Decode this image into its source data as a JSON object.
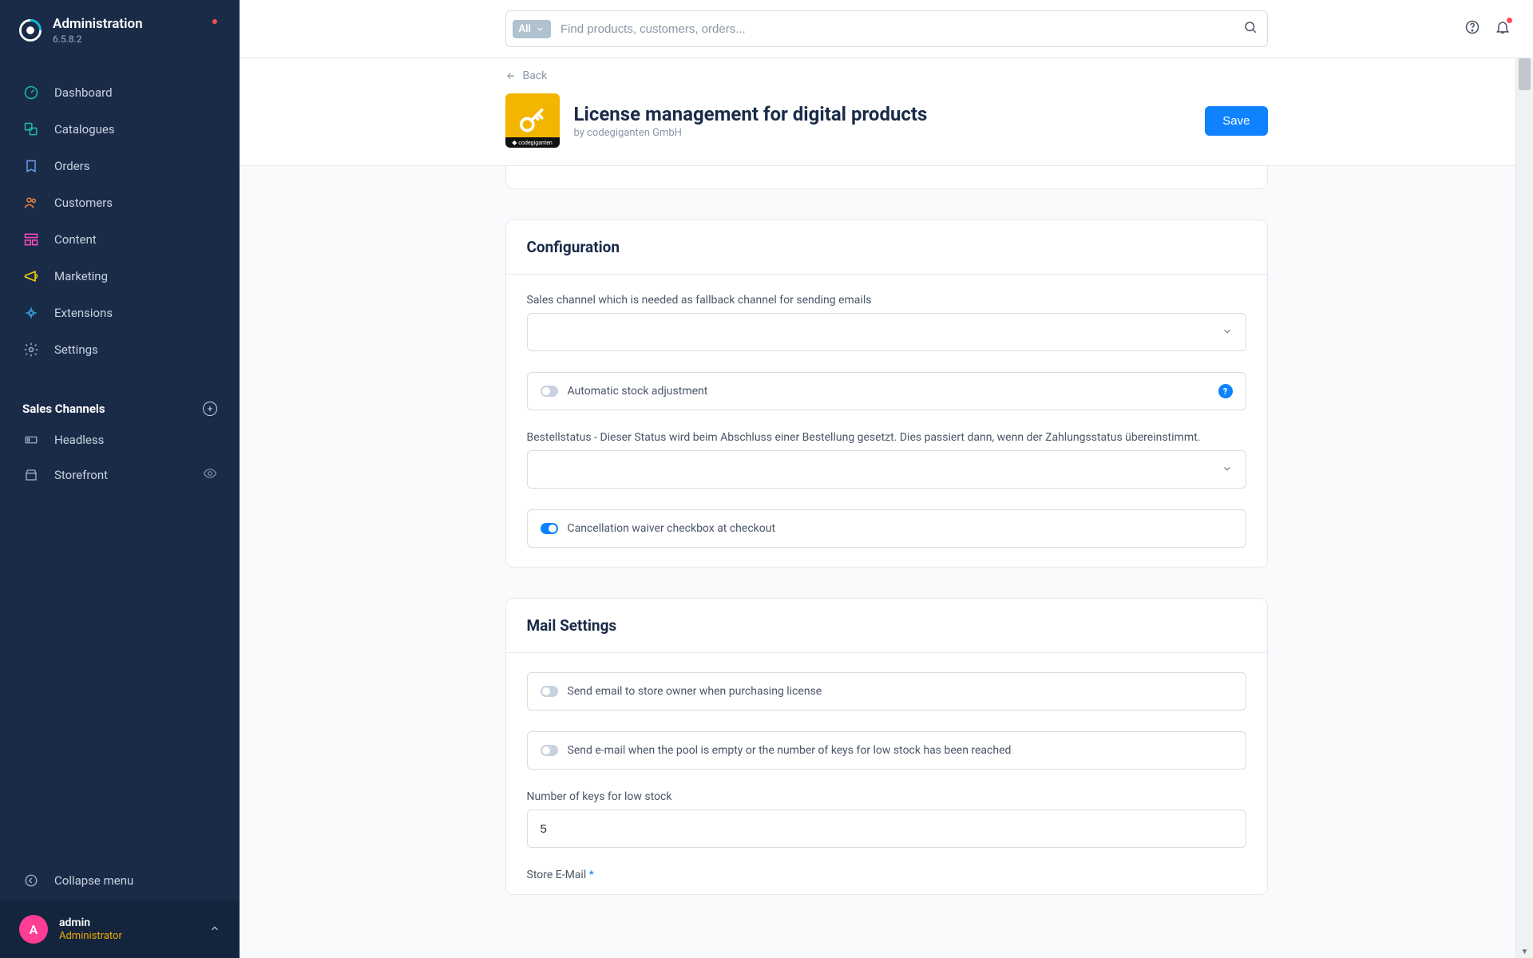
{
  "sidebar": {
    "title": "Administration",
    "version": "6.5.8.2",
    "nav": [
      {
        "label": "Dashboard",
        "icon": "dashboard"
      },
      {
        "label": "Catalogues",
        "icon": "catalogue"
      },
      {
        "label": "Orders",
        "icon": "orders"
      },
      {
        "label": "Customers",
        "icon": "customers"
      },
      {
        "label": "Content",
        "icon": "content"
      },
      {
        "label": "Marketing",
        "icon": "marketing"
      },
      {
        "label": "Extensions",
        "icon": "extensions"
      },
      {
        "label": "Settings",
        "icon": "settings"
      }
    ],
    "section_title": "Sales Channels",
    "channels": [
      {
        "label": "Headless",
        "icon": "headless",
        "eye": false
      },
      {
        "label": "Storefront",
        "icon": "storefront",
        "eye": true
      }
    ],
    "collapse_label": "Collapse menu",
    "user": {
      "initial": "A",
      "name": "admin",
      "role": "Administrator"
    }
  },
  "search": {
    "filter_label": "All",
    "placeholder": "Find products, customers, orders..."
  },
  "header": {
    "back_label": "Back",
    "title": "License management for digital products",
    "subtitle": "by codegiganten GmbH",
    "save_label": "Save",
    "plugin_badge": "codegiganten"
  },
  "config": {
    "title": "Configuration",
    "sales_channel_label": "Sales channel which is needed as fallback channel for sending emails",
    "auto_stock_label": "Automatic stock adjustment",
    "auto_stock_on": false,
    "order_status_label": "Bestellstatus - Dieser Status wird beim Abschluss einer Bestellung gesetzt. Dies passiert dann, wenn der Zahlungsstatus übereinstimmt.",
    "cancel_waiver_label": "Cancellation waiver checkbox at checkout",
    "cancel_waiver_on": true
  },
  "mail": {
    "title": "Mail Settings",
    "owner_email_label": "Send email to store owner when purchasing license",
    "owner_email_on": false,
    "pool_empty_label": "Send e-mail when the pool is empty or the number of keys for low stock has been reached",
    "pool_empty_on": false,
    "low_stock_label": "Number of keys for low stock",
    "low_stock_value": "5",
    "store_email_label": "Store E-Mail"
  }
}
